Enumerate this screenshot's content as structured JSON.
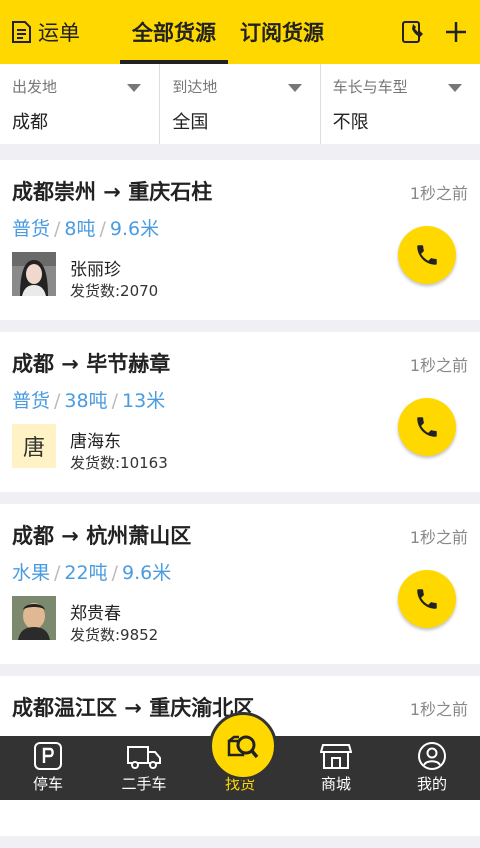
{
  "header": {
    "waybill_label": "运单",
    "tabs": [
      {
        "label": "全部货源",
        "active": true
      },
      {
        "label": "订阅货源",
        "active": false
      }
    ]
  },
  "filters": [
    {
      "label": "出发地",
      "value": "成都"
    },
    {
      "label": "到达地",
      "value": "全国"
    },
    {
      "label": "车长与车型",
      "value": "不限"
    }
  ],
  "cards": [
    {
      "route": "成都崇州 → 重庆石柱",
      "time": "1秒之前",
      "cargo": "普货",
      "weight": "8吨",
      "length": "9.6米",
      "name": "张丽珍",
      "count": "发货数:2070"
    },
    {
      "route": "成都 → 毕节赫章",
      "time": "1秒之前",
      "cargo": "普货",
      "weight": "38吨",
      "length": "13米",
      "name": "唐海东",
      "avatar_text": "唐",
      "count": "发货数:10163"
    },
    {
      "route": "成都 → 杭州萧山区",
      "time": "1秒之前",
      "cargo": "水果",
      "weight": "22吨",
      "length": "9.6米",
      "name": "郑贵春",
      "count": "发货数:9852"
    },
    {
      "route": "成都温江区 → 重庆渝北区",
      "time": "1秒之前"
    }
  ],
  "bottom_nav": [
    {
      "label": "停车",
      "icon": "parking-icon"
    },
    {
      "label": "二手车",
      "icon": "truck-icon"
    },
    {
      "label": "找货",
      "icon": "find-cargo-icon",
      "active": true
    },
    {
      "label": "商城",
      "icon": "store-icon"
    },
    {
      "label": "我的",
      "icon": "profile-icon"
    }
  ],
  "colors": {
    "accent": "#ffd800",
    "link": "#4a9be0",
    "nav_bg": "#333333"
  }
}
